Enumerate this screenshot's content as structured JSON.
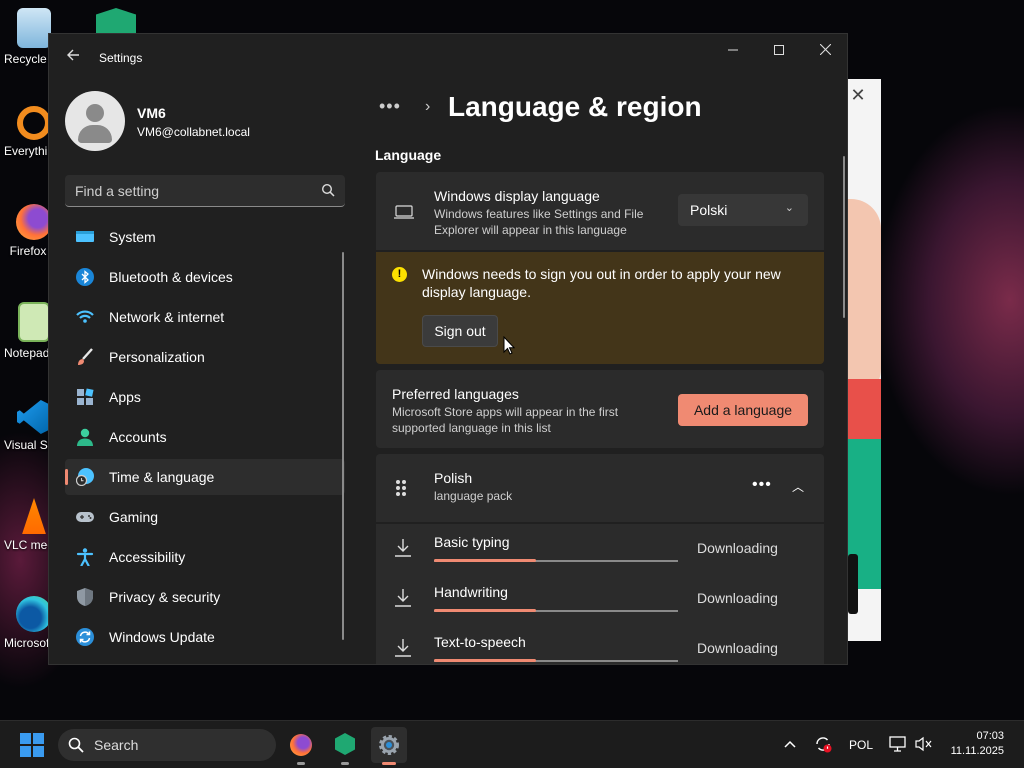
{
  "desktop": {
    "icons": [
      {
        "label": "Recycle Bin"
      },
      {
        "label": "Everything"
      },
      {
        "label": "Firefox"
      },
      {
        "label": "Notepad++"
      },
      {
        "label": "Visual Studio Code"
      },
      {
        "label": "VLC media player"
      },
      {
        "label": "Microsoft Edge"
      }
    ]
  },
  "window": {
    "title": "Settings",
    "controls": {
      "minimize": "—",
      "maximize": "☐",
      "close": "✕"
    }
  },
  "profile": {
    "name": "VM6",
    "email": "VM6@collabnet.local"
  },
  "search": {
    "placeholder": "Find a setting"
  },
  "sidebar": {
    "items": [
      {
        "label": "System",
        "icon": "system-icon"
      },
      {
        "label": "Bluetooth & devices",
        "icon": "bluetooth-icon"
      },
      {
        "label": "Network & internet",
        "icon": "network-icon"
      },
      {
        "label": "Personalization",
        "icon": "brush-icon"
      },
      {
        "label": "Apps",
        "icon": "apps-icon"
      },
      {
        "label": "Accounts",
        "icon": "accounts-icon"
      },
      {
        "label": "Time & language",
        "icon": "time-language-icon",
        "active": true
      },
      {
        "label": "Gaming",
        "icon": "gaming-icon"
      },
      {
        "label": "Accessibility",
        "icon": "accessibility-icon"
      },
      {
        "label": "Privacy & security",
        "icon": "shield-icon"
      },
      {
        "label": "Windows Update",
        "icon": "update-icon"
      }
    ]
  },
  "header": {
    "breadcrumb_more": "•••",
    "title": "Language & region"
  },
  "language_section": {
    "heading": "Language",
    "display_language": {
      "title": "Windows display language",
      "description": "Windows features like Settings and File Explorer will appear in this language",
      "selected": "Polski"
    },
    "warning": {
      "message": "Windows needs to sign you out in order to apply your new display language.",
      "button": "Sign out"
    },
    "preferred": {
      "title": "Preferred languages",
      "description": "Microsoft Store apps will appear in the first supported language in this list",
      "button": "Add a language"
    },
    "polish": {
      "name": "Polish",
      "subtitle": "language pack",
      "more": "•••",
      "features": [
        {
          "name": "Basic typing",
          "status": "Downloading",
          "progress": 0.42
        },
        {
          "name": "Handwriting",
          "status": "Downloading",
          "progress": 0.42
        },
        {
          "name": "Text-to-speech",
          "status": "Downloading",
          "progress": 0.42
        }
      ]
    }
  },
  "taskbar": {
    "search": "Search",
    "language": "POL",
    "time": "07:03",
    "date": "11.11.2025",
    "accent": "#f08a72"
  }
}
